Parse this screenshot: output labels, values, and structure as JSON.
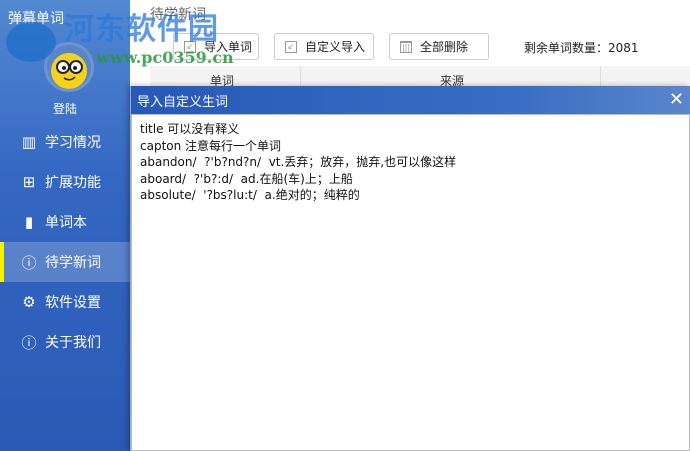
{
  "app": {
    "title": "弹幕单词",
    "login": "登陆"
  },
  "nav": [
    {
      "label": "学习情况",
      "icon": "bar-chart-icon"
    },
    {
      "label": "扩展功能",
      "icon": "grid-icon"
    },
    {
      "label": "单词本",
      "icon": "books-icon"
    },
    {
      "label": "待学新词",
      "icon": "question-icon",
      "active": true
    },
    {
      "label": "软件设置",
      "icon": "gear-icon"
    },
    {
      "label": "关于我们",
      "icon": "info-icon"
    }
  ],
  "main": {
    "title": "待学新词",
    "toolbar": {
      "import": "导入单词",
      "custom_import": "自定义导入",
      "delete_all": "全部删除"
    },
    "count_label": "剩余单词数量：2081",
    "columns": [
      "单词",
      "来源"
    ]
  },
  "dialog": {
    "title": "导入自定义生词",
    "close": "✕",
    "content": "title 可以没有释义\ncapton 注意每行一个单词\nabandon/  ?'b?nd?n/  vt.丢弃；放弃，抛弃,也可以像这样\naboard/  ?'b?:d/  ad.在船(车)上；上船\nabsolute/  '?bs?lu:t/  a.绝对的；纯粹的"
  },
  "watermark": {
    "name": "河东软件园",
    "url": "www.pc0359.cn"
  }
}
